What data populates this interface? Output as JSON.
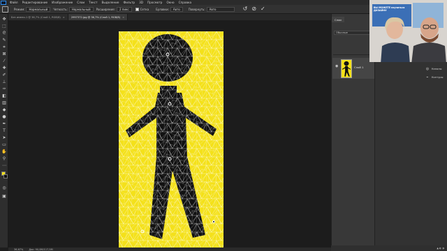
{
  "menu": {
    "items": [
      "Файл",
      "Редактирование",
      "Изображение",
      "Слои",
      "Текст",
      "Выделение",
      "Фильтр",
      "3D",
      "Просмотр",
      "Окно",
      "Справка"
    ]
  },
  "options_bar": {
    "mode_label": "Режим:",
    "mode_value": "Нормальный",
    "quality_label": "Четкость:",
    "quality_value": "Нормальный",
    "expansion_label": "Расширение:",
    "expansion_value": "2 пикс",
    "grid_checkbox_label": "Сетка",
    "grid_checked": true,
    "pins_label": "Булавки:",
    "pins_value": "Авто",
    "rotate_label": "Повернуть:",
    "rotate_value": "Авто"
  },
  "tabs": [
    {
      "label": "Без имени-1 @ 36,7% (Слой 1, RGB/8)",
      "active": false
    },
    {
      "label": "2997372.jpg @ 36,7% (Слой 1, RGB/8)",
      "active": true
    }
  ],
  "status_bar": {
    "zoom": "36,67%",
    "doc": "Док: 90,0M/117,5M"
  },
  "layers_panel": {
    "tab_label": "Слои",
    "kind_filter": "Обычные",
    "layer_name": "Слой 1"
  },
  "properties_panel": {
    "items": [
      {
        "icon": "circle-icon",
        "label": "Каналы"
      },
      {
        "icon": "path-icon",
        "label": "Контуры"
      }
    ]
  },
  "webcam": {
    "poster_title": "ВЫ МОЖЕТЕ научиться ДИЗАЙНУ"
  },
  "colors": {
    "canvas_bg": "#1c1c1c",
    "figure_yellow": "#f4e11a",
    "figure_black": "#111111",
    "mesh_lines": "#ffffff"
  }
}
